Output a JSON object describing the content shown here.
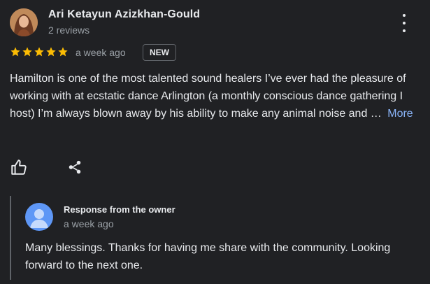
{
  "review": {
    "reviewer_name": "Ari Ketayun Azizkhan-Gould",
    "review_count": "2 reviews",
    "rating": 5,
    "star_color": "#fbbc04",
    "time_ago": "a week ago",
    "badge": "NEW",
    "text": "Hamilton is one of the most talented sound healers I’ve ever had the pleasure of working with at ecstatic dance Arlington (a monthly conscious dance gathering I host) I’m always blown away by his ability to make any animal noise and …",
    "more_label": "More",
    "actions": {
      "like_icon": "thumbs-up-icon",
      "share_icon": "share-icon"
    }
  },
  "owner_response": {
    "title": "Response from the owner",
    "time_ago": "a week ago",
    "text": "Many blessings. Thanks for having me share with the community. Looking forward to the next one."
  },
  "colors": {
    "background": "#202124",
    "link": "#8ab4f8",
    "owner_avatar": "#5e97f6"
  }
}
